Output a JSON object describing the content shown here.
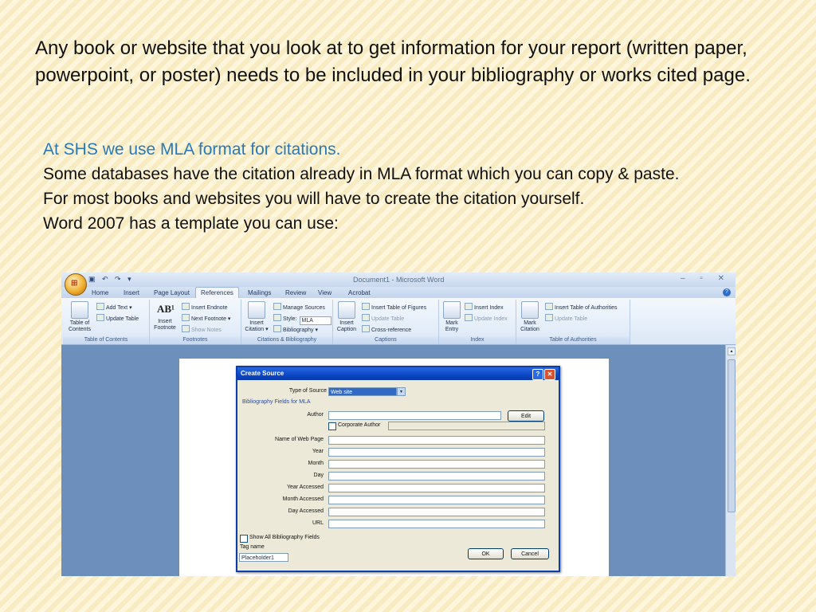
{
  "slide": {
    "intro": "Any book or website that you look at to get information for your report (written paper, powerpoint, or poster) needs to be included in your bibliography or works cited page.",
    "highlight": "At SHS we use MLA format for citations.",
    "line2": "Some databases have the citation already in MLA format which you can copy & paste.",
    "line3": "For most books and websites you will have to create the citation yourself.",
    "line4": "Word 2007 has a template you can use:"
  },
  "word": {
    "window_title": "Document1 - Microsoft Word",
    "tabs": [
      "Home",
      "Insert",
      "Page Layout",
      "References",
      "Mailings",
      "Review",
      "View",
      "Acrobat"
    ],
    "active_tab": "References",
    "ribbon": {
      "toc": {
        "big": "Table of Contents",
        "add_text": "Add Text",
        "update_table": "Update Table",
        "label": "Table of Contents"
      },
      "footnotes": {
        "big": "Insert Footnote",
        "insert_endnote": "Insert Endnote",
        "next_footnote": "Next Footnote",
        "show_notes": "Show Notes",
        "label": "Footnotes"
      },
      "citations": {
        "big": "Insert Citation",
        "manage_sources": "Manage Sources",
        "style_label": "Style:",
        "style_value": "MLA",
        "bibliography": "Bibliography",
        "label": "Citations & Bibliography"
      },
      "captions": {
        "big": "Insert Caption",
        "insert_table_figures": "Insert Table of Figures",
        "update_table": "Update Table",
        "cross_reference": "Cross-reference",
        "label": "Captions"
      },
      "index": {
        "big": "Mark Entry",
        "insert_index": "Insert Index",
        "update_index": "Update Index",
        "label": "Index"
      },
      "authorities": {
        "big": "Mark Citation",
        "insert_table": "Insert Table of Authorities",
        "update_table": "Update Table",
        "label": "Table of Authorities"
      }
    },
    "dialog": {
      "title": "Create Source",
      "type_label": "Type of Source",
      "type_value": "Web site",
      "fields_caption": "Bibliography Fields for MLA",
      "author_label": "Author",
      "edit_button": "Edit",
      "corporate_author": "Corporate Author",
      "fields": [
        "Name of Web Page",
        "Year",
        "Month",
        "Day",
        "Year Accessed",
        "Month Accessed",
        "Day Accessed",
        "URL"
      ],
      "show_all": "Show All Bibliography Fields",
      "tag_label": "Tag name",
      "tag_value": "Placeholder1",
      "ok_button": "OK",
      "cancel_button": "Cancel"
    }
  },
  "colors": {
    "highlight": "#2a7ab8",
    "dialog_title": "#0b46c8",
    "doc_background": "#6d8fbc"
  }
}
